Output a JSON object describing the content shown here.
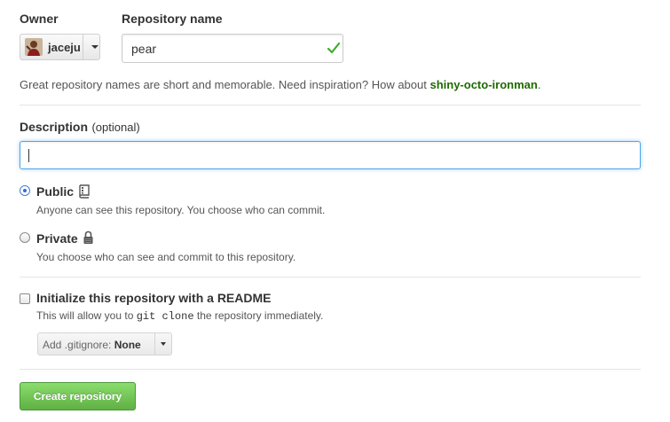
{
  "owner": {
    "label": "Owner",
    "selected": "jaceju"
  },
  "repository": {
    "label": "Repository name",
    "value": "pear",
    "hint_prefix": "Great repository names are short and memorable. Need inspiration? How about ",
    "suggestion": "shiny-octo-ironman",
    "hint_suffix": "."
  },
  "description": {
    "label": "Description",
    "optional": "(optional)",
    "value": ""
  },
  "visibility": {
    "public": {
      "label": "Public",
      "desc": "Anyone can see this repository. You choose who can commit.",
      "checked": true
    },
    "private": {
      "label": "Private",
      "desc": "You choose who can see and commit to this repository.",
      "checked": false
    }
  },
  "init": {
    "label": "Initialize this repository with a README",
    "desc_prefix": "This will allow you to ",
    "desc_code": "git clone",
    "desc_suffix": " the repository immediately.",
    "checked": false
  },
  "gitignore": {
    "prefix": "Add .gitignore: ",
    "value": "None"
  },
  "create_button": "Create repository",
  "colors": {
    "accent_green": "#60b044",
    "suggestion_green": "#1e6b00",
    "focus_blue": "#51a7e8"
  },
  "icons": {
    "owner_caret": "chevron-down-icon",
    "valid": "check-icon",
    "public": "repo-icon",
    "private": "lock-icon"
  }
}
